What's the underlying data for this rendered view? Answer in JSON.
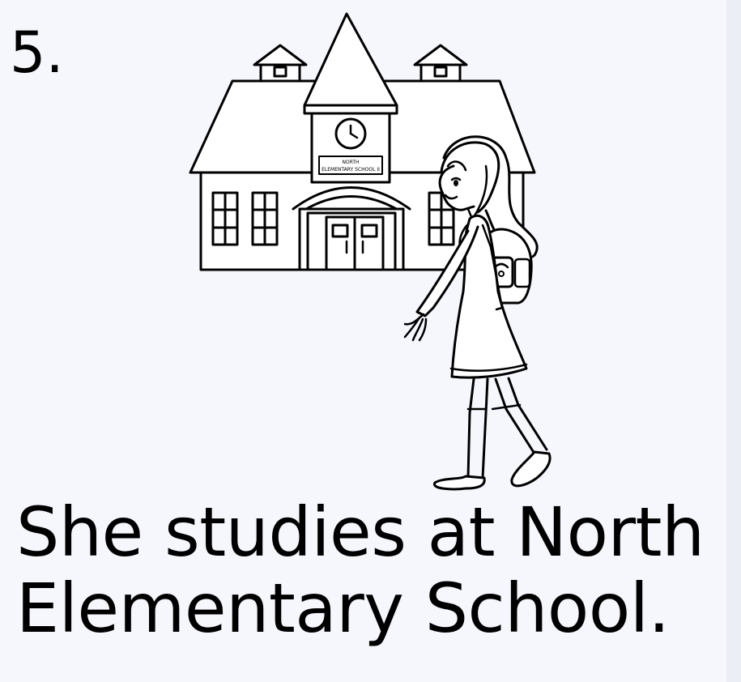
{
  "item_number": "5.",
  "sign": {
    "line1": "NORTH",
    "line2": "ELEMENTARY SCHOOL II"
  },
  "caption": {
    "line1": "She studies at North",
    "line2": "Elementary School."
  }
}
